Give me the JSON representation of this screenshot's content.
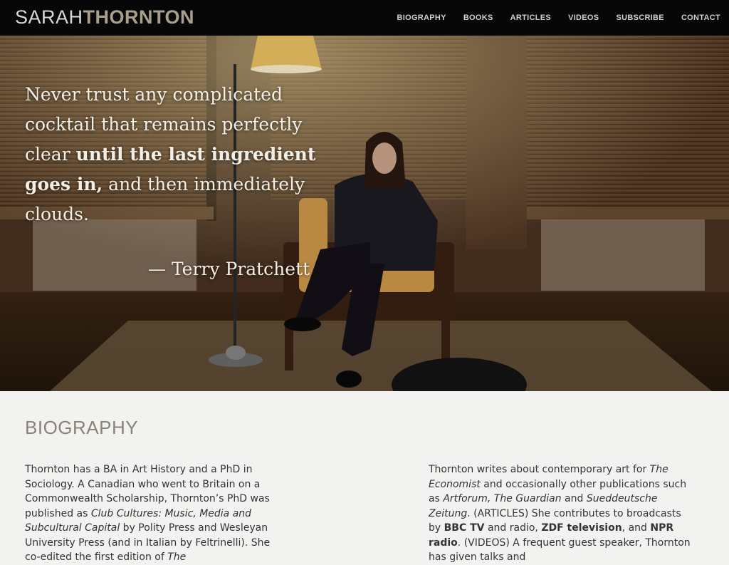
{
  "site": {
    "logo_light": "SARAH",
    "logo_bold": "THORNTON"
  },
  "nav": {
    "items": [
      {
        "label": "BIOGRAPHY"
      },
      {
        "label": "BOOKS"
      },
      {
        "label": "ARTICLES"
      },
      {
        "label": "VIDEOS"
      },
      {
        "label": "SUBSCRIBE"
      },
      {
        "label": "CONTACT"
      }
    ]
  },
  "hero": {
    "quote_part1": "Never trust any complicated cocktail that remains perfectly clear ",
    "quote_bold": "until the last ingredient goes in,",
    "quote_part2": " and then immediately clouds.",
    "attribution": "— Terry Pratchett"
  },
  "biography": {
    "heading": "BIOGRAPHY",
    "left": {
      "t1": "Thornton has a BA in Art History and a PhD in Sociology. A Canadian who went to Britain on a Commonwealth Scholarship, Thornton’s PhD was published as ",
      "i1": "Club Cultures: Music, Media and Subcultural Capital",
      "t2": " by Polity Press and Wesleyan University Press (and in Italian by Feltrinelli). She co-edited the first edition of ",
      "i2": "The"
    },
    "right": {
      "t1": "Thornton writes about contemporary art for ",
      "i1": "The Economist",
      "t2": " and occasionally other publications such as ",
      "i2": "Artforum, The Guardian",
      "t3": " and ",
      "i3": "Sueddeutsche Zeitung",
      "t4": ". (ARTICLES) She contributes to broadcasts by ",
      "b1": "BBC TV",
      "t5": " and radio, ",
      "b2": "ZDF television",
      "t6": ", and ",
      "b3": "NPR radio",
      "t7": ". (VIDEOS) A frequent guest speaker, Thornton has given talks and"
    }
  }
}
